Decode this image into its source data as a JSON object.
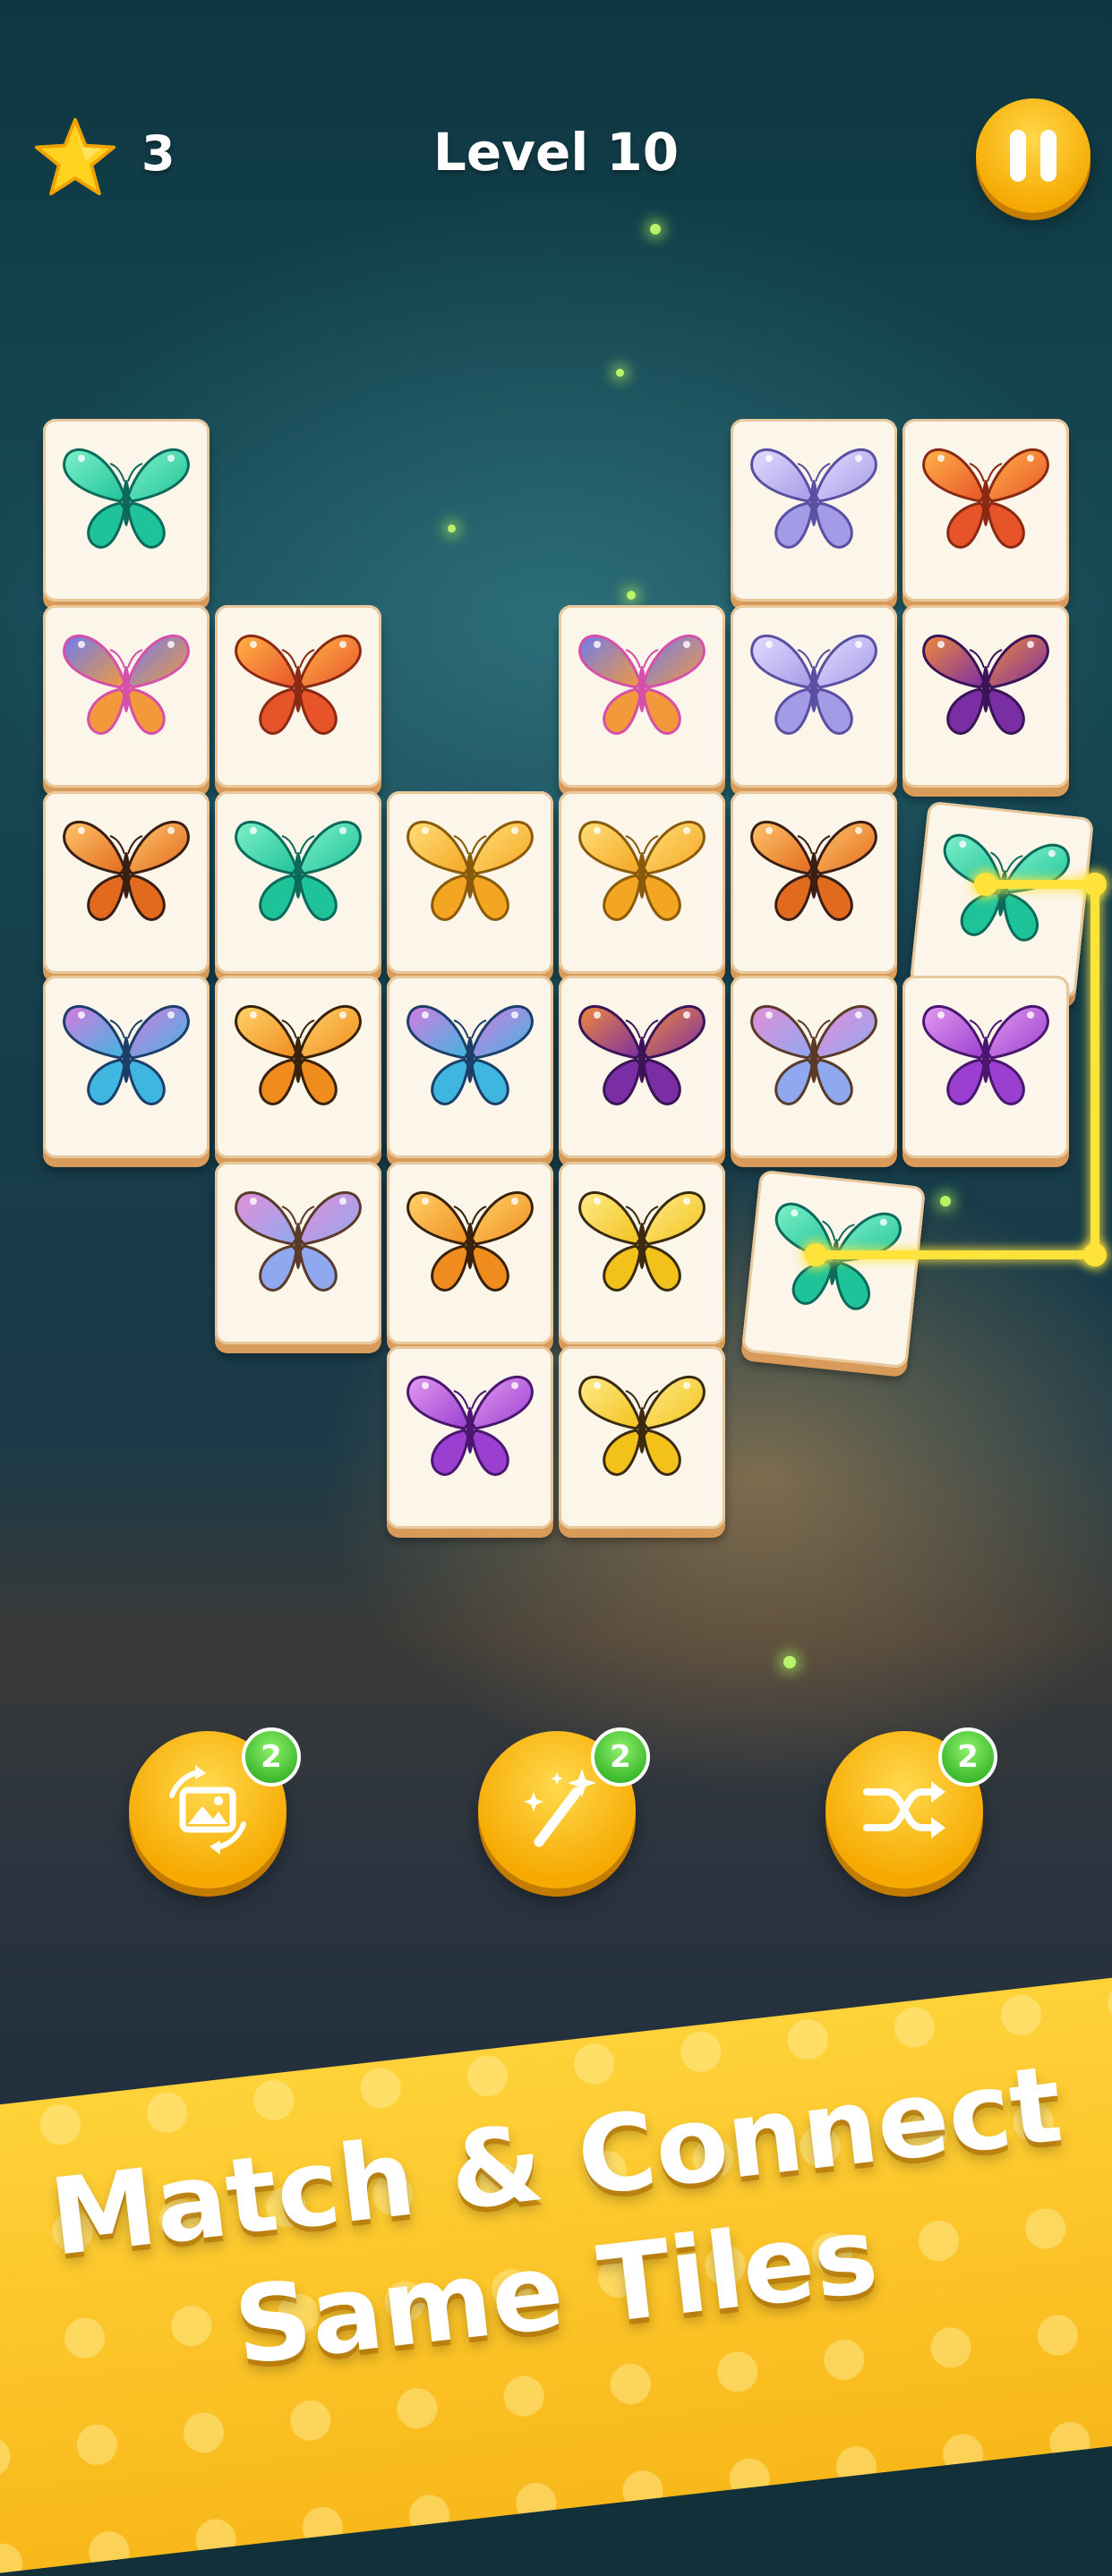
{
  "header": {
    "star_count": "3",
    "level_title": "Level 10"
  },
  "board": {
    "tiles": [
      {
        "butterfly": "teal-green"
      },
      {
        "butterfly": "lavender"
      },
      {
        "butterfly": "orange-red"
      },
      {
        "butterfly": "rainbow"
      },
      {
        "butterfly": "orange-red"
      },
      {
        "butterfly": "rainbow"
      },
      {
        "butterfly": "lavender"
      },
      {
        "butterfly": "purple-orange"
      },
      {
        "butterfly": "dark-orange"
      },
      {
        "butterfly": "teal-green"
      },
      {
        "butterfly": "yellow-orange"
      },
      {
        "butterfly": "yellow-orange"
      },
      {
        "butterfly": "dark-orange"
      },
      {
        "butterfly": "teal-green"
      },
      {
        "butterfly": "iridescent-blue"
      },
      {
        "butterfly": "orange-swallowtail"
      },
      {
        "butterfly": "iridescent-blue"
      },
      {
        "butterfly": "purple-orange"
      },
      {
        "butterfly": "holographic"
      },
      {
        "butterfly": "violet"
      },
      {
        "butterfly": "holographic"
      },
      {
        "butterfly": "orange-swallowtail"
      },
      {
        "butterfly": "spotted-yellow"
      },
      {
        "butterfly": "teal-green"
      },
      {
        "butterfly": "violet"
      },
      {
        "butterfly": "spotted-yellow"
      }
    ],
    "matched_pair": "teal-green",
    "connector_color": "#ffe23a"
  },
  "boosters": [
    {
      "name": "swap-image",
      "count": "2"
    },
    {
      "name": "magic-wand-hint",
      "count": "2"
    },
    {
      "name": "shuffle",
      "count": "2"
    }
  ],
  "banner": {
    "line1": "Match & Connect",
    "line2": "Same Tiles"
  },
  "colors": {
    "accent_gold": "#f6a900",
    "badge_green": "#3bb82c",
    "tile_face": "#fbf5ea"
  }
}
